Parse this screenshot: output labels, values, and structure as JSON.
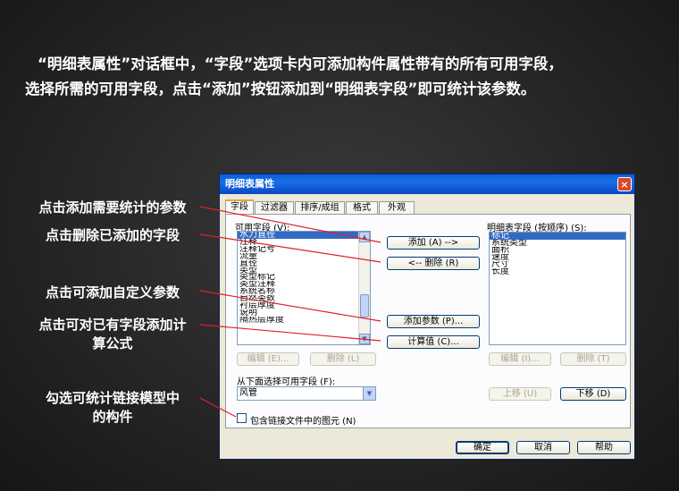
{
  "intro": {
    "line1": "“明细表属性”对话框中，“字段”选项卡内可添加构件属性带有的所有可用字段，",
    "line2": "选择所需的可用字段，点击“添加”按钮添加到“明细表字段”即可统计该参数。"
  },
  "callouts": {
    "add": "点击添加需要统计的参数",
    "remove": "点击删除已添加的字段",
    "custom": "点击可添加自定义参数",
    "formula_1": "点击可对已有字段添加计",
    "formula_2": "算公式",
    "linked_1": "勾选可统计链接模型中",
    "linked_2": "的构件"
  },
  "dialog": {
    "title": "明细表属性",
    "close": "×",
    "tabs": [
      "字段",
      "过滤器",
      "排序/成组",
      "格式",
      "外观"
    ],
    "available_label": "可用字段 (V):",
    "available_items": [
      "水力直径",
      "注释",
      "注释记号",
      "流量",
      "直径",
      "类型",
      "类型标记",
      "类型注释",
      "系统名称",
      "自然类数",
      "衬层厚度",
      "说明",
      "隔热层厚度"
    ],
    "available_selected": "水力直径",
    "scheduled_label": "明细表字段 (按顺序) (S):",
    "scheduled_items": [
      "标记",
      "系统类型",
      "面积",
      "速度",
      "尺寸",
      "长度"
    ],
    "scheduled_selected": "标记",
    "buttons": {
      "add": "添加 (A) -->",
      "remove": "<-- 删除 (R)",
      "add_param": "添加参数 (P)...",
      "calc": "计算值 (C)...",
      "edit_left": "编辑 (E)...",
      "delete_left": "删除 (L)",
      "edit_right": "编辑 (I)...",
      "delete_right": "删除 (T)",
      "move_up": "上移 (U)",
      "move_down": "下移 (D)",
      "ok": "确定",
      "cancel": "取消",
      "help": "帮助"
    },
    "select_from_label": "从下面选择可用字段 (F):",
    "select_from_value": "风管",
    "include_linked_label": "包含链接文件中的图元 (N)",
    "include_linked_checked": false
  }
}
